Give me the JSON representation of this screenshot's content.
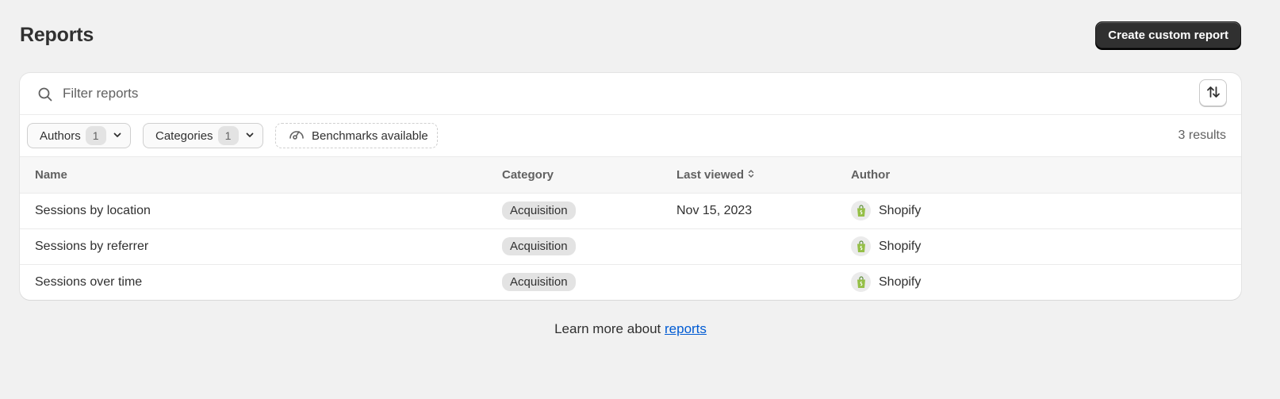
{
  "header": {
    "title": "Reports",
    "create_button": "Create custom report"
  },
  "search": {
    "placeholder": "Filter reports",
    "value": ""
  },
  "filters": {
    "authors": {
      "label": "Authors",
      "count": "1"
    },
    "categories": {
      "label": "Categories",
      "count": "1"
    },
    "benchmarks": {
      "label": "Benchmarks available"
    },
    "results": "3 results"
  },
  "table": {
    "columns": {
      "name": "Name",
      "category": "Category",
      "last_viewed": "Last viewed",
      "author": "Author"
    },
    "rows": [
      {
        "name": "Sessions by location",
        "category": "Acquisition",
        "last_viewed": "Nov 15, 2023",
        "author": "Shopify"
      },
      {
        "name": "Sessions by referrer",
        "category": "Acquisition",
        "last_viewed": "",
        "author": "Shopify"
      },
      {
        "name": "Sessions over time",
        "category": "Acquisition",
        "last_viewed": "",
        "author": "Shopify"
      }
    ]
  },
  "footer": {
    "text": "Learn more about ",
    "link": "reports"
  },
  "icons": {
    "search": "search-icon",
    "sort": "sort-arrows-icon",
    "chevron": "chevron-down-icon",
    "benchmark": "gauge-icon",
    "author": "shopify-bag-icon"
  },
  "colors": {
    "background": "#f1f1f1",
    "primary_button": "#303030",
    "link": "#005bd3",
    "shopify_green": "#95bf47"
  }
}
